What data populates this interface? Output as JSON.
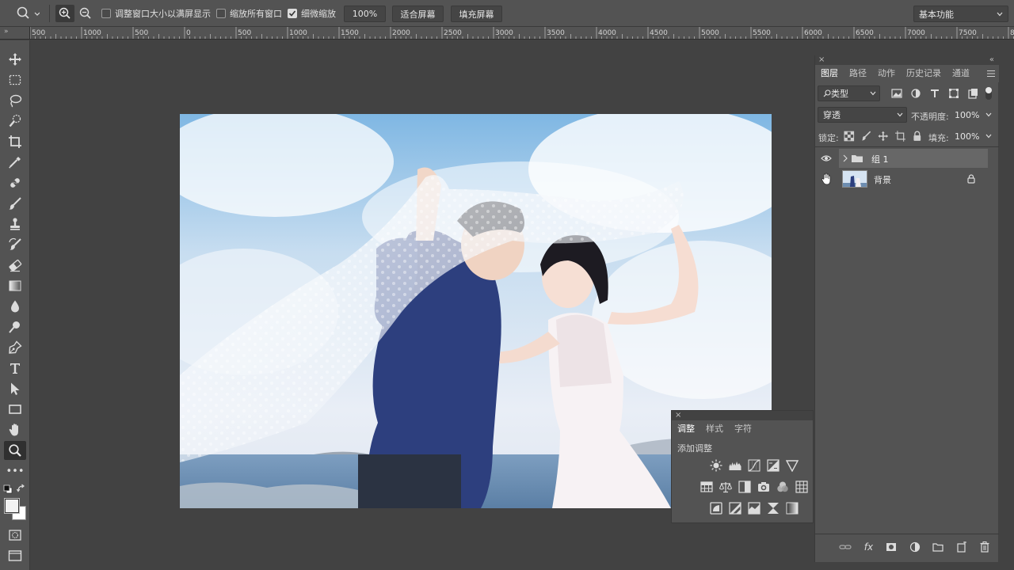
{
  "options_bar": {
    "zoom_tool_icon": "zoom-icon",
    "zoom_in_icon": "zoom-in-icon",
    "zoom_out_icon": "zoom-out-icon",
    "resize_windows_label": "调整窗口大小以满屏显示",
    "resize_windows_checked": false,
    "zoom_all_windows_label": "缩放所有窗口",
    "zoom_all_windows_checked": false,
    "scrubby_zoom_label": "细微缩放",
    "scrubby_zoom_checked": true,
    "zoom_value": "100%",
    "fit_screen_label": "适合屏幕",
    "fill_screen_label": "填充屏幕",
    "workspace_label": "基本功能"
  },
  "ruler": {
    "corner_label": "»",
    "labels": [
      "500",
      "1000",
      "500",
      "0",
      "500",
      "1000",
      "1500",
      "2000",
      "2500",
      "3000",
      "3500",
      "4000",
      "4500",
      "5000",
      "5500",
      "6000",
      "6500",
      "7000",
      "7500",
      "8"
    ]
  },
  "toolbar": {
    "tools": [
      "move-icon",
      "marquee-icon",
      "lasso-icon",
      "quick-select-icon",
      "crop-icon",
      "eyedropper-icon",
      "healing-brush-icon",
      "brush-icon",
      "stamp-icon",
      "history-brush-icon",
      "eraser-icon",
      "gradient-icon",
      "blur-icon",
      "dodge-icon",
      "pen-icon",
      "type-icon",
      "path-select-icon",
      "rectangle-icon",
      "hand-icon",
      "zoom-icon"
    ],
    "active_tool": "zoom-icon",
    "more_label": "•••"
  },
  "layers_panel": {
    "tabs": [
      "图层",
      "路径",
      "动作",
      "历史记录",
      "通道"
    ],
    "active_tab": "图层",
    "filter_label": "类型",
    "blend_mode": "穿透",
    "opacity_label": "不透明度:",
    "opacity_value": "100%",
    "lock_label": "锁定:",
    "fill_label": "填充:",
    "fill_value": "100%",
    "layers": [
      {
        "name": "组 1",
        "type": "group",
        "visible": true,
        "selected": true
      },
      {
        "name": "背景",
        "type": "image",
        "visible": true,
        "locked": true,
        "selected": false
      }
    ]
  },
  "adjustments_panel": {
    "tabs": [
      "调整",
      "样式",
      "字符"
    ],
    "active_tab": "调整",
    "add_label": "添加调整"
  }
}
